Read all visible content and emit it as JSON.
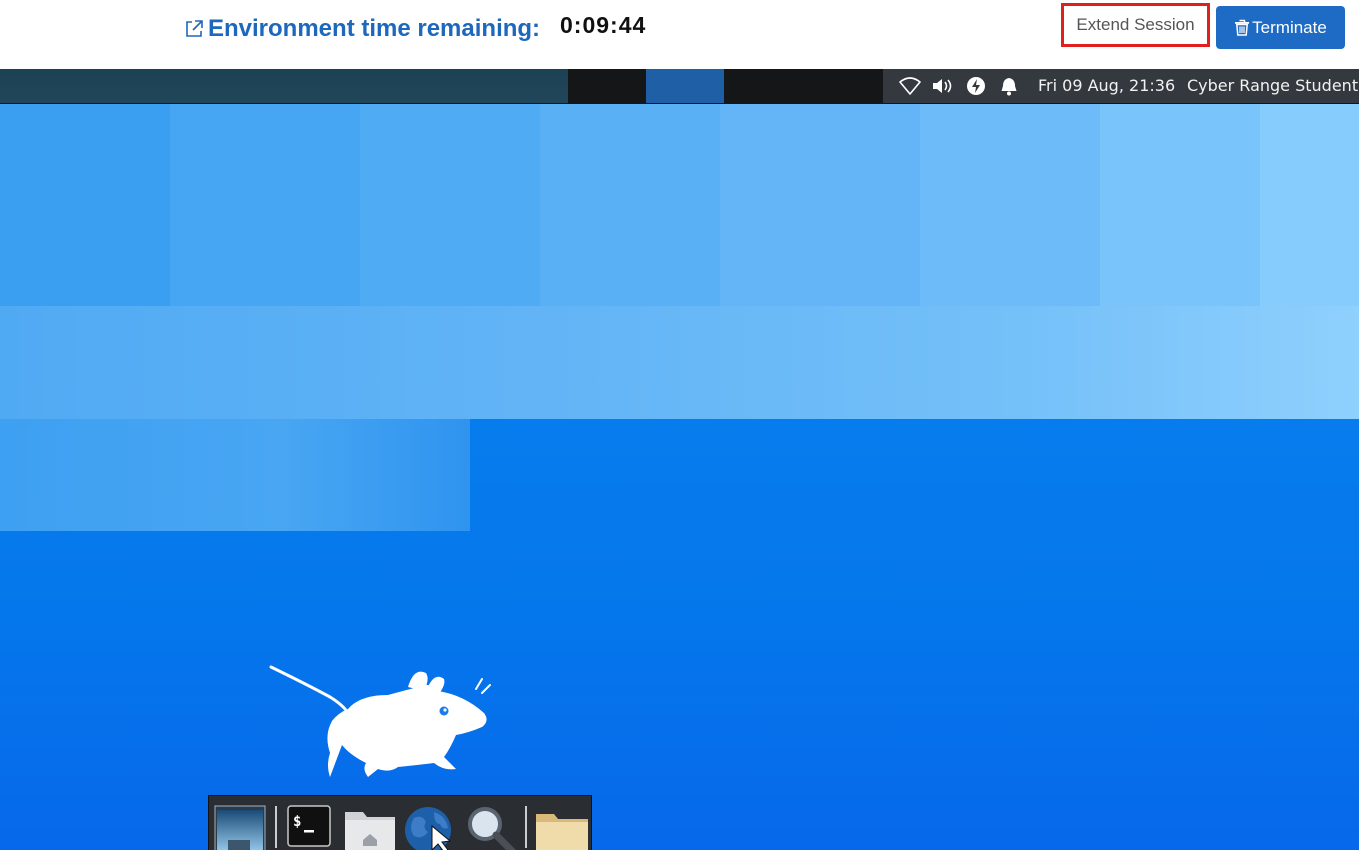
{
  "header": {
    "env_label": "Environment time remaining:",
    "time_remaining": "0:09:44",
    "extend_label": "Extend Session",
    "terminate_label": "Terminate",
    "icons": [
      "external-link-icon",
      "trash-icon"
    ],
    "colors": {
      "link": "#1d68bd",
      "extend_border": "#e0201e",
      "terminate_bg": "#1d6bc5"
    }
  },
  "desktop": {
    "panel": {
      "clock": "Fri 09 Aug, 21:36",
      "user": "Cyber Range Student",
      "tray_icons": [
        "wifi-icon",
        "volume-icon",
        "power-icon",
        "notification-bell-icon"
      ]
    },
    "dock": {
      "items": [
        "show-desktop-icon",
        "terminal-icon",
        "home-folder-icon",
        "web-browser-icon",
        "app-finder-icon",
        "file-manager-icon"
      ]
    },
    "wallpaper_logo": "xfce-mouse-logo"
  }
}
